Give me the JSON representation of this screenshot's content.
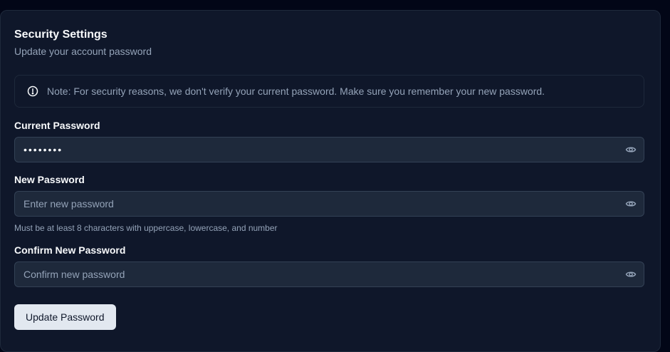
{
  "card": {
    "title": "Security Settings",
    "subtitle": "Update your account password"
  },
  "alert": {
    "icon": "alert-circle-icon",
    "text": "Note: For security reasons, we don't verify your current password. Make sure you remember your new password."
  },
  "fields": {
    "current": {
      "label": "Current Password",
      "value": "••••••••",
      "icon": "eye-icon"
    },
    "new": {
      "label": "New Password",
      "placeholder": "Enter new password",
      "hint": "Must be at least 8 characters with uppercase, lowercase, and number",
      "icon": "eye-icon"
    },
    "confirm": {
      "label": "Confirm New Password",
      "placeholder": "Confirm new password",
      "icon": "eye-icon"
    }
  },
  "actions": {
    "submit_label": "Update Password"
  },
  "colors": {
    "page_bg": "#020617",
    "card_bg": "#0f172a",
    "input_bg": "#1e293b",
    "muted_text": "#94a3b8",
    "button_bg": "#e2e8f0"
  }
}
